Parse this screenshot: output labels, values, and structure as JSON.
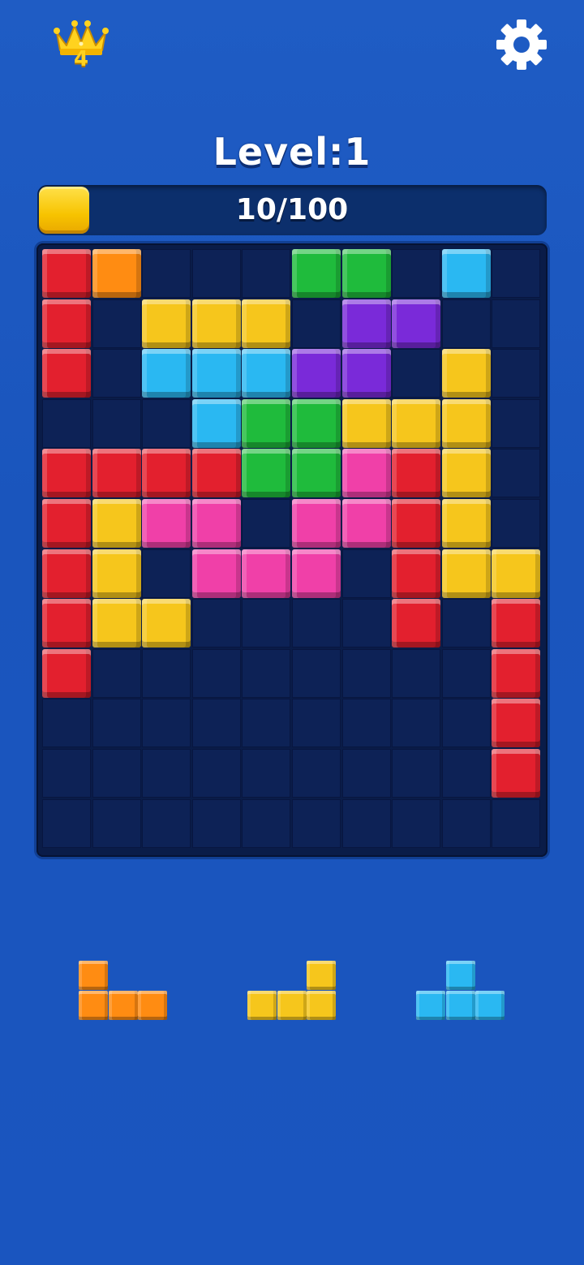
{
  "header": {
    "crown_count": "4",
    "crown_icon": "crown-icon",
    "settings_icon": "gear-icon"
  },
  "level": {
    "title": "Level:1"
  },
  "progress": {
    "text": "10/100",
    "value": 10,
    "max": 100
  },
  "colors": {
    "R": "#e3202e",
    "O": "#ff8c12",
    "G": "#1fbb3c",
    "C": "#2ab8f2",
    "Y": "#f6c61c",
    "P": "#7a2ad9",
    "K": "#f040a8",
    "empty": "#0d2256"
  },
  "board": {
    "cols": 10,
    "rows": 12,
    "grid": [
      "RO...GG.C.",
      "R.YYY.PP..",
      "R.CCCPP.Y.",
      "...CGGYYY.",
      "RRRRGGKRY.",
      "RYKK.KKRY.",
      "RY.KKK.RYY",
      "RYY....R.R",
      "R........R",
      ".........R",
      ".........R",
      ".........."
    ]
  },
  "tray": {
    "pieces": [
      {
        "name": "orange-l-piece",
        "color": "O",
        "cells": [
          [
            0,
            0
          ],
          [
            0,
            1
          ],
          [
            1,
            1
          ],
          [
            2,
            1
          ]
        ]
      },
      {
        "name": "yellow-j-piece",
        "color": "Y",
        "cells": [
          [
            2,
            0
          ],
          [
            0,
            1
          ],
          [
            1,
            1
          ],
          [
            2,
            1
          ]
        ]
      },
      {
        "name": "cyan-t-piece",
        "color": "C",
        "cells": [
          [
            1,
            0
          ],
          [
            0,
            1
          ],
          [
            1,
            1
          ],
          [
            2,
            1
          ]
        ]
      }
    ]
  }
}
